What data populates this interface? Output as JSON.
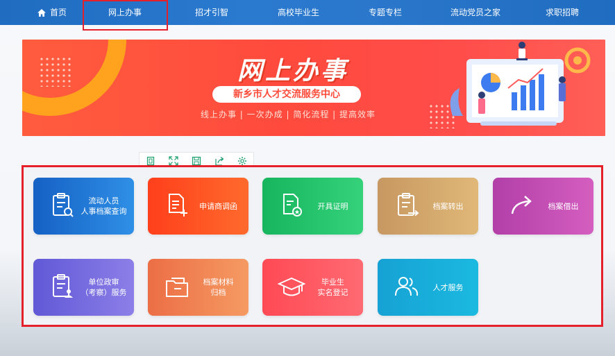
{
  "nav": {
    "items": [
      {
        "label": "首页",
        "icon": "home-icon"
      },
      {
        "label": "网上办事",
        "active": true
      },
      {
        "label": "招才引智"
      },
      {
        "label": "高校毕业生"
      },
      {
        "label": "专题专栏"
      },
      {
        "label": "流动党员之家"
      },
      {
        "label": "求职招聘"
      }
    ]
  },
  "banner": {
    "title": "网上办事",
    "subtitle": "新乡市人才交流服务中心",
    "slogan": "线上办事 | 一次办成 | 简化流程 | 提高效率"
  },
  "toolbar": {
    "icons": [
      "frame-icon",
      "fullscreen-icon",
      "save-icon",
      "share-icon",
      "settings-icon"
    ]
  },
  "services": [
    {
      "label": "流动人员\n人事档案查询",
      "icon": "clipboard-search-icon",
      "color": "#1561c4"
    },
    {
      "label": "申请商调函",
      "icon": "document-add-icon",
      "color": "#ff3f1b"
    },
    {
      "label": "开具证明",
      "icon": "certificate-icon",
      "color": "#16b55e"
    },
    {
      "label": "档案转出",
      "icon": "clipboard-transfer-icon",
      "color": "#c79861"
    },
    {
      "label": "档案借出",
      "icon": "share-arrow-icon",
      "color": "#b23fa8"
    },
    {
      "label": "单位政审\n（考察）服务",
      "icon": "clipboard-user-icon",
      "color": "#6158d6"
    },
    {
      "label": "档案材料\n归档",
      "icon": "folder-icon",
      "color": "#ec6e45"
    },
    {
      "label": "毕业生\n实名登记",
      "icon": "graduation-cap-icon",
      "color": "#ff4a55"
    },
    {
      "label": "人才服务",
      "icon": "users-icon",
      "color": "#16a2d4"
    }
  ]
}
